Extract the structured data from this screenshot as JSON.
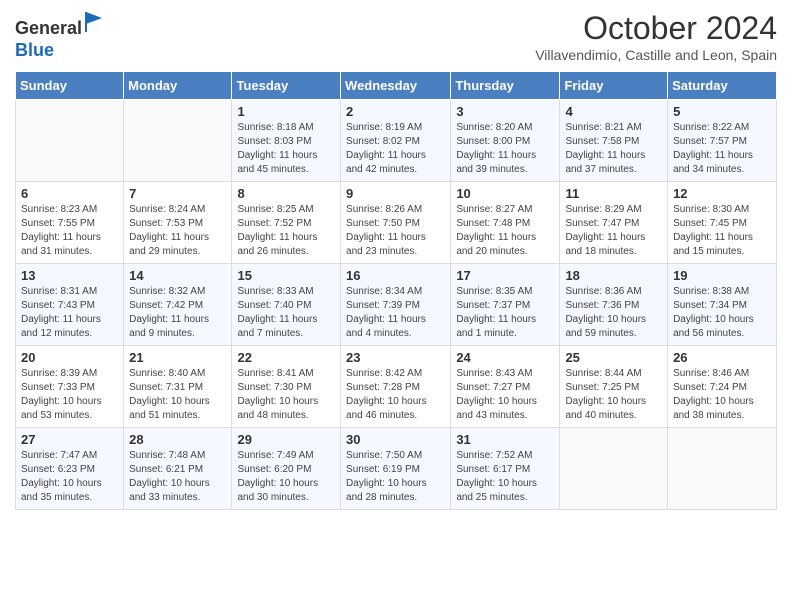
{
  "logo": {
    "general": "General",
    "blue": "Blue"
  },
  "header": {
    "month": "October 2024",
    "location": "Villavendimio, Castille and Leon, Spain"
  },
  "weekdays": [
    "Sunday",
    "Monday",
    "Tuesday",
    "Wednesday",
    "Thursday",
    "Friday",
    "Saturday"
  ],
  "weeks": [
    [
      {
        "day": "",
        "info": ""
      },
      {
        "day": "",
        "info": ""
      },
      {
        "day": "1",
        "info": "Sunrise: 8:18 AM\nSunset: 8:03 PM\nDaylight: 11 hours and 45 minutes."
      },
      {
        "day": "2",
        "info": "Sunrise: 8:19 AM\nSunset: 8:02 PM\nDaylight: 11 hours and 42 minutes."
      },
      {
        "day": "3",
        "info": "Sunrise: 8:20 AM\nSunset: 8:00 PM\nDaylight: 11 hours and 39 minutes."
      },
      {
        "day": "4",
        "info": "Sunrise: 8:21 AM\nSunset: 7:58 PM\nDaylight: 11 hours and 37 minutes."
      },
      {
        "day": "5",
        "info": "Sunrise: 8:22 AM\nSunset: 7:57 PM\nDaylight: 11 hours and 34 minutes."
      }
    ],
    [
      {
        "day": "6",
        "info": "Sunrise: 8:23 AM\nSunset: 7:55 PM\nDaylight: 11 hours and 31 minutes."
      },
      {
        "day": "7",
        "info": "Sunrise: 8:24 AM\nSunset: 7:53 PM\nDaylight: 11 hours and 29 minutes."
      },
      {
        "day": "8",
        "info": "Sunrise: 8:25 AM\nSunset: 7:52 PM\nDaylight: 11 hours and 26 minutes."
      },
      {
        "day": "9",
        "info": "Sunrise: 8:26 AM\nSunset: 7:50 PM\nDaylight: 11 hours and 23 minutes."
      },
      {
        "day": "10",
        "info": "Sunrise: 8:27 AM\nSunset: 7:48 PM\nDaylight: 11 hours and 20 minutes."
      },
      {
        "day": "11",
        "info": "Sunrise: 8:29 AM\nSunset: 7:47 PM\nDaylight: 11 hours and 18 minutes."
      },
      {
        "day": "12",
        "info": "Sunrise: 8:30 AM\nSunset: 7:45 PM\nDaylight: 11 hours and 15 minutes."
      }
    ],
    [
      {
        "day": "13",
        "info": "Sunrise: 8:31 AM\nSunset: 7:43 PM\nDaylight: 11 hours and 12 minutes."
      },
      {
        "day": "14",
        "info": "Sunrise: 8:32 AM\nSunset: 7:42 PM\nDaylight: 11 hours and 9 minutes."
      },
      {
        "day": "15",
        "info": "Sunrise: 8:33 AM\nSunset: 7:40 PM\nDaylight: 11 hours and 7 minutes."
      },
      {
        "day": "16",
        "info": "Sunrise: 8:34 AM\nSunset: 7:39 PM\nDaylight: 11 hours and 4 minutes."
      },
      {
        "day": "17",
        "info": "Sunrise: 8:35 AM\nSunset: 7:37 PM\nDaylight: 11 hours and 1 minute."
      },
      {
        "day": "18",
        "info": "Sunrise: 8:36 AM\nSunset: 7:36 PM\nDaylight: 10 hours and 59 minutes."
      },
      {
        "day": "19",
        "info": "Sunrise: 8:38 AM\nSunset: 7:34 PM\nDaylight: 10 hours and 56 minutes."
      }
    ],
    [
      {
        "day": "20",
        "info": "Sunrise: 8:39 AM\nSunset: 7:33 PM\nDaylight: 10 hours and 53 minutes."
      },
      {
        "day": "21",
        "info": "Sunrise: 8:40 AM\nSunset: 7:31 PM\nDaylight: 10 hours and 51 minutes."
      },
      {
        "day": "22",
        "info": "Sunrise: 8:41 AM\nSunset: 7:30 PM\nDaylight: 10 hours and 48 minutes."
      },
      {
        "day": "23",
        "info": "Sunrise: 8:42 AM\nSunset: 7:28 PM\nDaylight: 10 hours and 46 minutes."
      },
      {
        "day": "24",
        "info": "Sunrise: 8:43 AM\nSunset: 7:27 PM\nDaylight: 10 hours and 43 minutes."
      },
      {
        "day": "25",
        "info": "Sunrise: 8:44 AM\nSunset: 7:25 PM\nDaylight: 10 hours and 40 minutes."
      },
      {
        "day": "26",
        "info": "Sunrise: 8:46 AM\nSunset: 7:24 PM\nDaylight: 10 hours and 38 minutes."
      }
    ],
    [
      {
        "day": "27",
        "info": "Sunrise: 7:47 AM\nSunset: 6:23 PM\nDaylight: 10 hours and 35 minutes."
      },
      {
        "day": "28",
        "info": "Sunrise: 7:48 AM\nSunset: 6:21 PM\nDaylight: 10 hours and 33 minutes."
      },
      {
        "day": "29",
        "info": "Sunrise: 7:49 AM\nSunset: 6:20 PM\nDaylight: 10 hours and 30 minutes."
      },
      {
        "day": "30",
        "info": "Sunrise: 7:50 AM\nSunset: 6:19 PM\nDaylight: 10 hours and 28 minutes."
      },
      {
        "day": "31",
        "info": "Sunrise: 7:52 AM\nSunset: 6:17 PM\nDaylight: 10 hours and 25 minutes."
      },
      {
        "day": "",
        "info": ""
      },
      {
        "day": "",
        "info": ""
      }
    ]
  ]
}
